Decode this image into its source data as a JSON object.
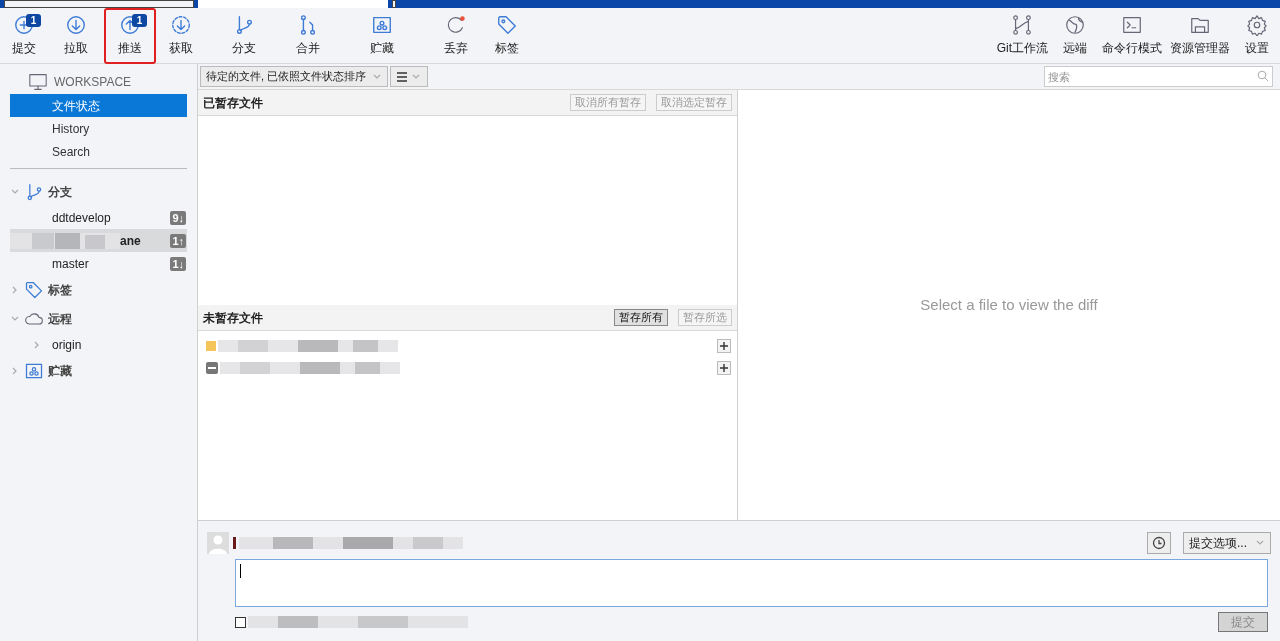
{
  "window_tabs": [
    {
      "selected": false
    },
    {
      "selected": true
    },
    {
      "selected": false
    }
  ],
  "toolbar": {
    "left": [
      {
        "label": "提交",
        "kind": "plus",
        "badge": "1",
        "highlighted": false
      },
      {
        "label": "拉取",
        "kind": "down",
        "highlighted": false
      },
      {
        "label": "推送",
        "kind": "up",
        "badge": "1",
        "highlighted": true
      },
      {
        "label": "获取",
        "kind": "fetch",
        "highlighted": false
      },
      {
        "label": "分支",
        "kind": "branch",
        "highlighted": false
      },
      {
        "label": "合并",
        "kind": "merge",
        "highlighted": false
      },
      {
        "label": "贮藏",
        "kind": "stash",
        "highlighted": false
      },
      {
        "label": "丢弃",
        "kind": "discard",
        "highlighted": false
      },
      {
        "label": "标签",
        "kind": "tag",
        "highlighted": false
      }
    ],
    "right": [
      {
        "label": "Git工作流",
        "kind": "flow"
      },
      {
        "label": "远端",
        "kind": "globe"
      },
      {
        "label": "命令行模式",
        "kind": "terminal"
      },
      {
        "label": "资源管理器",
        "kind": "folder"
      },
      {
        "label": "设置",
        "kind": "gear"
      }
    ]
  },
  "sidebar": {
    "workspace": {
      "title": "WORKSPACE",
      "items": [
        {
          "label": "文件状态",
          "selected": true
        },
        {
          "label": "History",
          "selected": false
        },
        {
          "label": "Search",
          "selected": false
        }
      ]
    },
    "sections": [
      {
        "title": "分支",
        "kind": "branch",
        "expanded": true,
        "children": [
          {
            "label": "ddtdevelop",
            "badge": "9↓",
            "current": false,
            "kind": "plain"
          },
          {
            "label": "ane",
            "badge": "1↑",
            "current": true,
            "kind": "obscured"
          },
          {
            "label": "master",
            "badge": "1↓",
            "current": false,
            "kind": "plain"
          }
        ]
      },
      {
        "title": "标签",
        "kind": "tag",
        "expanded": false
      },
      {
        "title": "远程",
        "kind": "cloud",
        "expanded": true,
        "children": [
          {
            "label": "origin",
            "kind": "remote"
          }
        ]
      },
      {
        "title": "贮藏",
        "kind": "stash",
        "expanded": false
      }
    ]
  },
  "filter": {
    "sort": "待定的文件, 已依照文件状态排序",
    "search": {
      "placeholder": "搜索"
    }
  },
  "staged": {
    "title": "已暂存文件",
    "buttons": [
      {
        "label": "取消所有暂存",
        "disabled": true
      },
      {
        "label": "取消选定暂存",
        "disabled": true
      }
    ]
  },
  "unstaged": {
    "title": "未暂存文件",
    "buttons": [
      {
        "label": "暂存所有",
        "disabled": false
      },
      {
        "label": "暂存所选",
        "disabled": true
      }
    ],
    "files": [
      {
        "kind": "modified"
      },
      {
        "kind": "removed"
      }
    ]
  },
  "diff": {
    "message": "Select a file to view the diff"
  },
  "commit": {
    "options": "提交选项...",
    "checkbox": {
      "checked": false
    },
    "button": {
      "label": "提交",
      "disabled": true
    }
  }
}
